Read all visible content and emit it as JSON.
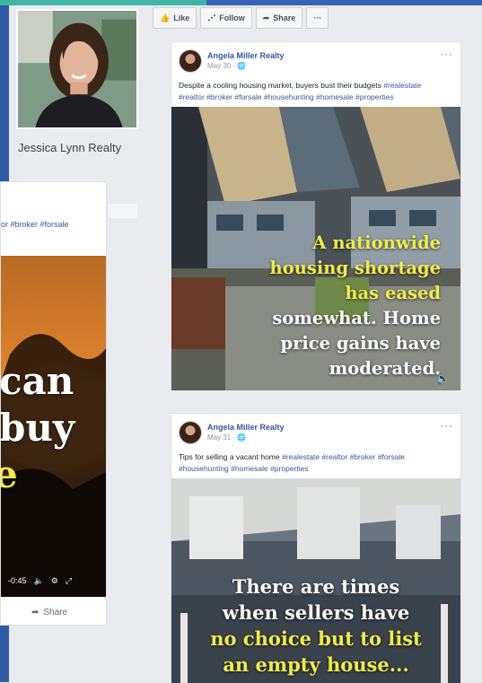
{
  "profile": {
    "name": "Jessica Lynn Realty"
  },
  "actions": {
    "like": "Like",
    "follow": "Follow",
    "share": "Share",
    "more": "···"
  },
  "left_card": {
    "tags": "or #broker #forsale",
    "overlay_lines": [
      "can",
      "buy",
      "e"
    ],
    "time": "-0:45",
    "share": "Share"
  },
  "posts": [
    {
      "author": "Angela Miller Realty",
      "date": "May 30 · ",
      "caption_text": "Despite a cooling housing market, buyers bust their budgets ",
      "caption_tags_1": "#realestate",
      "caption_tags_2": "#realtor #broker #forsale #househunting #homesale #properties",
      "overlay": {
        "line1": "A nationwide",
        "line2": "housing shortage",
        "line3": "has eased",
        "line4": "somewhat.  Home",
        "line5": "price gains have",
        "line6": "moderated."
      }
    },
    {
      "author": "Angela Miller Realty",
      "date": "May 31 · ",
      "caption_text": "Tips for selling a vacant home ",
      "caption_tags_1": "#realestate #realtor #broker #forsale",
      "caption_tags_2": "#househunting #homesale #properties",
      "overlay": {
        "line1": "There are times",
        "line2": "when sellers have",
        "line3": "no choice but to list",
        "line4": "an empty house..."
      }
    }
  ],
  "colors": {
    "link": "#385898",
    "overlay_yellow": "#ecec4a",
    "brand_blue": "#2f5ba5"
  }
}
